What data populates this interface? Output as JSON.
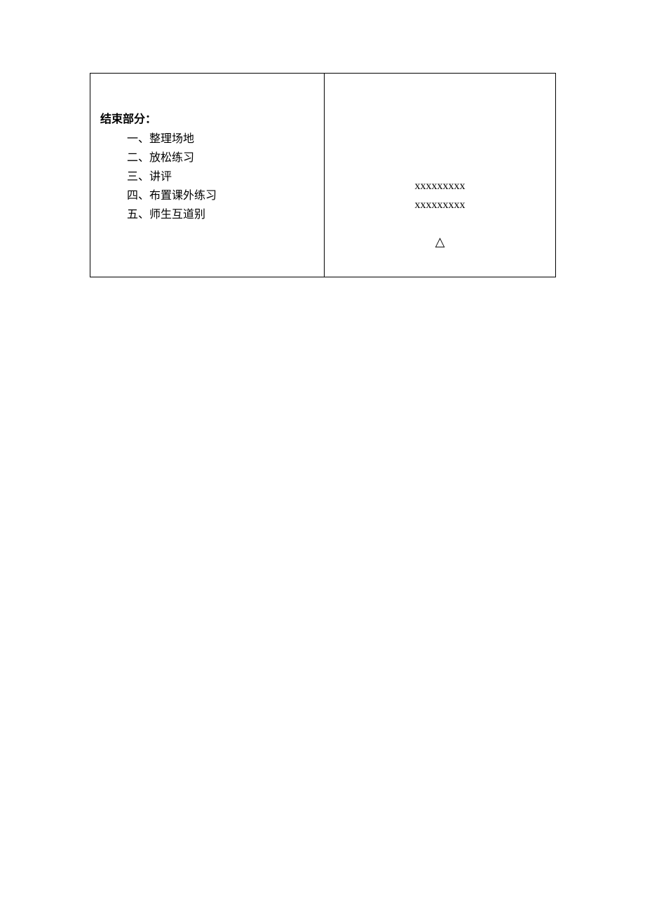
{
  "left_cell": {
    "heading": "结束部分：",
    "items": [
      "一、整理场地",
      "二、放松练习",
      "三、讲评",
      "四、布置课外练习",
      "五、师生互道别"
    ]
  },
  "right_cell": {
    "row1": "xxxxxxxxx",
    "row2": "xxxxxxxxx",
    "symbol": "△"
  }
}
